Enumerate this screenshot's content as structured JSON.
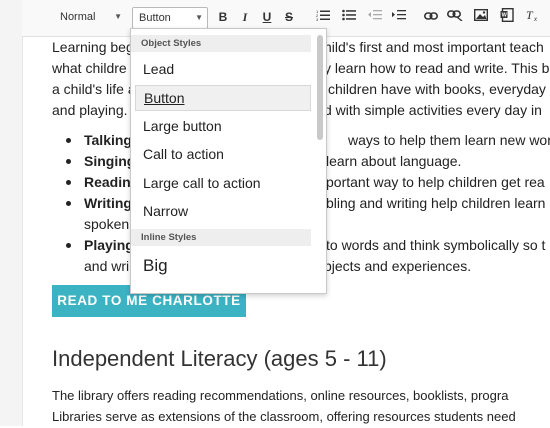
{
  "toolbar": {
    "format_select": "Normal",
    "style_select": "Button",
    "buttons": {
      "bold": "B",
      "italic": "I",
      "underline": "U",
      "strike": "S",
      "ordered_list": "⒈",
      "bullet_list": "•≡",
      "outdent": "⇤",
      "indent": "⇥",
      "link": "⚭",
      "unlink": "⚮",
      "image": "▣",
      "embed": "⧉",
      "clear_format": "Tx"
    }
  },
  "content": {
    "para_lines": [
      "Learning beg",
      "what childre",
      "a child's life a",
      "and playing."
    ],
    "para_right_lines": [
      "hild's first and most important teach",
      "y learn how to read and write. This b",
      "children have with books, everyday",
      "d with simple activities every day in"
    ],
    "bullets": [
      {
        "term": "Talking",
        "rest": "ways to help them learn new words"
      },
      {
        "term": "Singing",
        "rest": "learn about language."
      },
      {
        "term": "Readin",
        "rest": "portant way to help children get rea"
      },
      {
        "term": "Writing",
        "rest": "bling and writing help children learn",
        "rest2": "spoken"
      },
      {
        "term": "Playing",
        "rest": "to words and think symbolically so t",
        "rest2": "and wri",
        "rest2b": "bjects and experiences."
      }
    ],
    "cta_label": "READ TO ME CHARLOTTE",
    "heading": "Independent Literacy (ages 5 - 11)",
    "para2_lines": [
      "The library offers reading recommendations, online resources, booklists, progra",
      " Libraries serve as extensions of the classroom, offering resources students need"
    ]
  },
  "dropdown": {
    "group_object": "Object Styles",
    "object_items": [
      "Lead",
      "Button",
      "Large button",
      "Call to action",
      "Large call to action",
      "Narrow"
    ],
    "selected": "Button",
    "group_inline": "Inline Styles",
    "inline_items": [
      "Big"
    ]
  }
}
